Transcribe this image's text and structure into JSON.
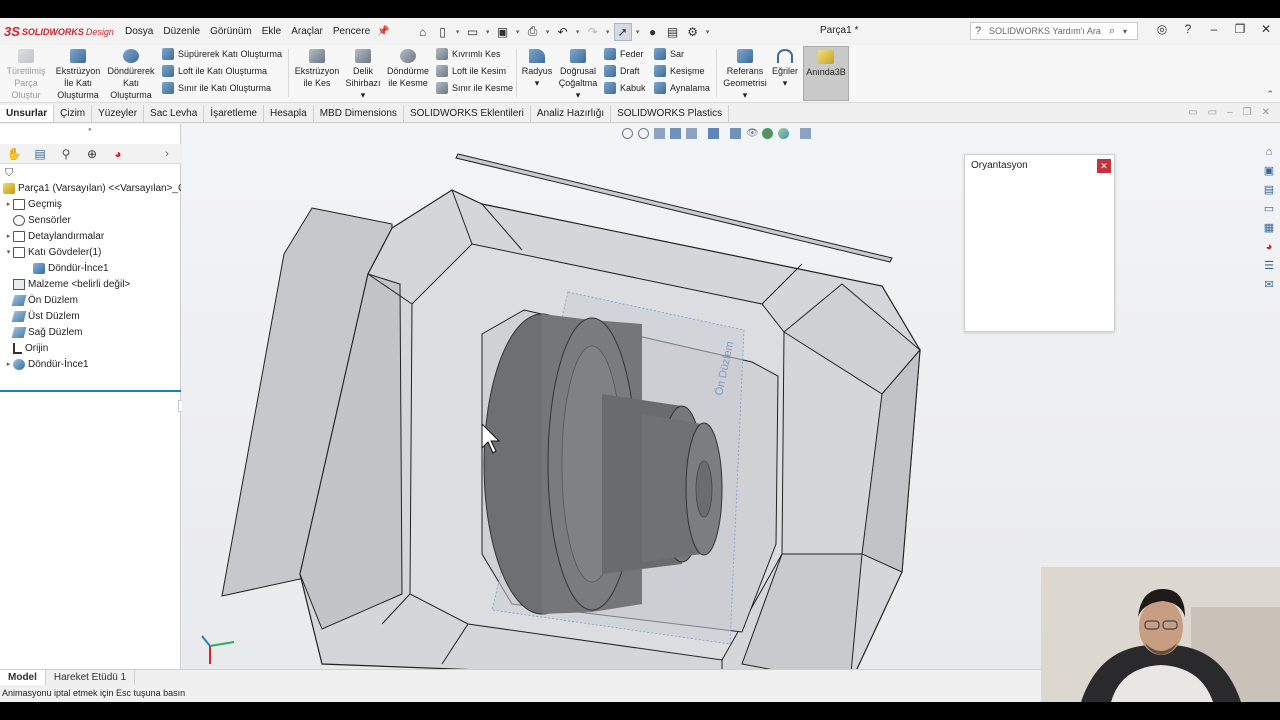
{
  "app": {
    "logo_ds": "3S",
    "logo_brand": "SOLIDWORKS",
    "logo_edition": "Design",
    "document_title": "Parça1 *"
  },
  "menu": [
    "Dosya",
    "Düzenle",
    "Görünüm",
    "Ekle",
    "Araçlar",
    "Pencere"
  ],
  "search": {
    "placeholder": "SOLIDWORKS Yardım'ı Ara"
  },
  "ribbon": {
    "derived_part": [
      "Türetilmiş",
      "Parça",
      "Oluştur"
    ],
    "extruded_boss": [
      "Ekstrüzyon",
      "İle Katı",
      "Oluşturma"
    ],
    "revolved_boss": [
      "Döndürerek",
      "Katı",
      "Oluşturma"
    ],
    "swept_boss": "Süpürerek Katı Oluşturma",
    "lofted_boss": "Loft ile Katı Oluşturma",
    "boundary_boss": "Sınır ile Katı Oluşturma",
    "extruded_cut": [
      "Ekstrüzyon",
      "ile Kes"
    ],
    "hole_wizard": [
      "Delik",
      "Sihirbazı"
    ],
    "revolved_cut": [
      "Döndürme",
      "ile Kesme"
    ],
    "swept_cut": "Kıvrımlı Kes",
    "lofted_cut": "Loft ile Kesim",
    "boundary_cut": "Sınır ile Kesme",
    "fillet": "Radyus",
    "linear_pattern": [
      "Doğrusal",
      "Çoğaltma"
    ],
    "rib": "Feder",
    "draft": "Draft",
    "shell": "Kabuk",
    "wrap": "Sar",
    "intersect": "Kesişme",
    "mirror": "Aynalama",
    "ref_geometry": [
      "Referans",
      "Geometrisi"
    ],
    "curves": "Eğriler",
    "instant3d": "Anında3B"
  },
  "command_tabs": [
    "Unsurlar",
    "Çizim",
    "Yüzeyler",
    "Sac Levha",
    "İşaretleme",
    "Hesapla",
    "MBD Dimensions",
    "SOLIDWORKS Eklentileri",
    "Analiz Hazırlığı",
    "SOLIDWORKS Plastics"
  ],
  "tree": {
    "root": "Parça1 (Varsayılan) <<Varsayılan>_G",
    "items": [
      {
        "label": "Geçmiş",
        "expandable": true
      },
      {
        "label": "Sensörler",
        "expandable": false
      },
      {
        "label": "Detaylandırmalar",
        "expandable": true
      },
      {
        "label": "Katı Gövdeler(1)",
        "expandable": true,
        "expanded": true
      },
      {
        "label": "Döndür-İnce1",
        "child": true
      },
      {
        "label": "Malzeme <belirli değil>",
        "expandable": false
      },
      {
        "label": "Ön Düzlem",
        "expandable": false
      },
      {
        "label": "Üst Düzlem",
        "expandable": false
      },
      {
        "label": "Sağ Düzlem",
        "expandable": false
      },
      {
        "label": "Orijin",
        "expandable": false
      },
      {
        "label": "Döndür-İnce1",
        "expandable": true
      }
    ]
  },
  "viewport": {
    "plane_label": "Ön Düzlem"
  },
  "orientation_dialog": {
    "title": "Oryantasyon"
  },
  "bottom_tabs": [
    "Model",
    "Hareket Etüdü 1"
  ],
  "status_text": "Animasyonu iptal etmek için Esc tuşuna basın",
  "colors": {
    "accent": "#1c7fb5",
    "brand": "#d4232b",
    "close": "#c3323f"
  }
}
